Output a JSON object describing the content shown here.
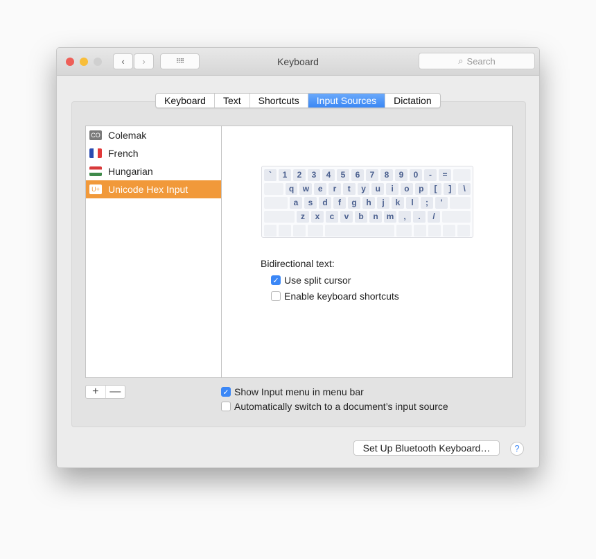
{
  "window": {
    "title": "Keyboard",
    "search_placeholder": "Search",
    "traffic_colors": [
      "#ee5f58",
      "#f8be3a",
      "#d0d0d0"
    ]
  },
  "tabs": [
    {
      "label": "Keyboard"
    },
    {
      "label": "Text"
    },
    {
      "label": "Shortcuts"
    },
    {
      "label": "Input Sources",
      "active": true
    },
    {
      "label": "Dictation"
    }
  ],
  "sources": [
    {
      "label": "Colemak",
      "icon": "CO",
      "kind": "co"
    },
    {
      "label": "French",
      "kind": "fr"
    },
    {
      "label": "Hungarian",
      "kind": "hu"
    },
    {
      "label": "Unicode Hex Input",
      "icon": "U+",
      "kind": "uni",
      "selected": true
    }
  ],
  "keyboard_rows": [
    [
      "`",
      "1",
      "2",
      "3",
      "4",
      "5",
      "6",
      "7",
      "8",
      "9",
      "0",
      "-",
      "="
    ],
    [
      "q",
      "w",
      "e",
      "r",
      "t",
      "y",
      "u",
      "i",
      "o",
      "p",
      "[",
      "]",
      "\\"
    ],
    [
      "a",
      "s",
      "d",
      "f",
      "g",
      "h",
      "j",
      "k",
      "l",
      ";",
      "'"
    ],
    [
      "z",
      "x",
      "c",
      "v",
      "b",
      "n",
      "m",
      ",",
      ".",
      "/"
    ]
  ],
  "bidi": {
    "label": "Bidirectional text:",
    "options": [
      {
        "label": "Use split cursor",
        "checked": true
      },
      {
        "label": "Enable keyboard shortcuts",
        "checked": false
      }
    ]
  },
  "bottom_options": [
    {
      "label": "Show Input menu in menu bar",
      "checked": true
    },
    {
      "label": "Automatically switch to a document’s input source",
      "checked": false
    }
  ],
  "add_label": "+",
  "remove_label": "—",
  "bluetooth_button": "Set Up Bluetooth Keyboard…",
  "help_label": "?",
  "colors": {
    "accent": "#3b87f6",
    "selection": "#f1993a"
  }
}
